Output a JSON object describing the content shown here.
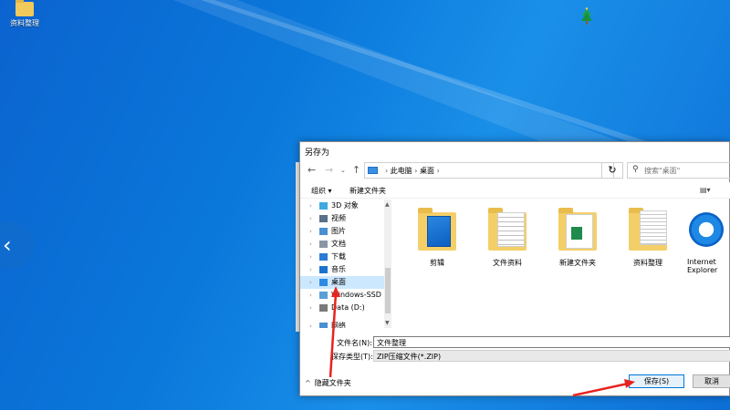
{
  "desktop": {
    "icon_label": "资料整理",
    "nav_arrow": "‹"
  },
  "dialog": {
    "title": "另存为",
    "breadcrumb": [
      "此电脑",
      "桌面"
    ],
    "search_placeholder": "搜索\"桌面\"",
    "toolbar": {
      "organize": "组织 ▾",
      "new_folder": "新建文件夹"
    },
    "nav_items": [
      {
        "label": "3D 对象",
        "icon": "cube-icon",
        "color": "#3fa9e0"
      },
      {
        "label": "视频",
        "icon": "video-icon",
        "color": "#5a6f8a"
      },
      {
        "label": "图片",
        "icon": "pictures-icon",
        "color": "#4a8fd2"
      },
      {
        "label": "文档",
        "icon": "documents-icon",
        "color": "#8a96a6"
      },
      {
        "label": "下载",
        "icon": "download-icon",
        "color": "#2a7ad6"
      },
      {
        "label": "音乐",
        "icon": "music-icon",
        "color": "#1c72cf"
      },
      {
        "label": "桌面",
        "icon": "desktop-icon",
        "color": "#2f8ae4"
      },
      {
        "label": "Windows-SSD (",
        "icon": "drive-icon",
        "color": "#5a9fd6"
      },
      {
        "label": "Data (D:)",
        "icon": "drive-icon",
        "color": "#7a7a7a"
      },
      {
        "label": "网络",
        "icon": "network-icon",
        "color": "#4a8fd2"
      }
    ],
    "selected_nav_index": 6,
    "files": [
      {
        "label": "剪辑",
        "icon": "folder-blue-icon"
      },
      {
        "label": "文件资料",
        "icon": "folder-docs-icon"
      },
      {
        "label": "新建文件夹",
        "icon": "folder-excel-icon"
      },
      {
        "label": "资料整理",
        "icon": "folder-papers-icon"
      },
      {
        "label": "Internet Explorer",
        "icon": "internet-explorer-icon"
      }
    ],
    "filename_label": "文件名(N):",
    "filename_value": "文件整理",
    "filetype_label": "保存类型(T):",
    "filetype_value": "ZIP压缩文件(*.ZIP)",
    "hide_folders": "隐藏文件夹",
    "save_button": "保存(S)",
    "cancel_button": "取消"
  },
  "colors": {
    "desktop_bg": "#0a78db",
    "selection": "#cce8ff",
    "annotation_arrow": "#e8231f",
    "accent": "#0078d7"
  }
}
